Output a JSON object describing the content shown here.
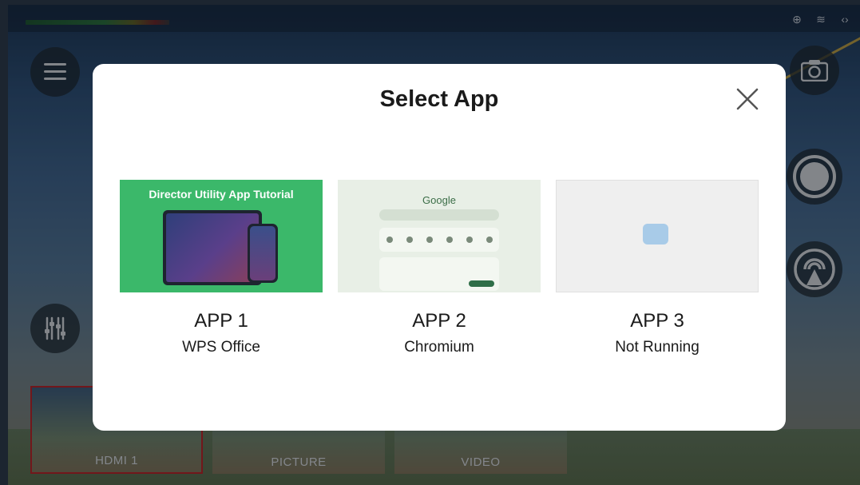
{
  "background": {
    "thumbnails": [
      {
        "label": "HDMI 1",
        "active": true
      },
      {
        "label": "PICTURE",
        "active": false
      },
      {
        "label": "VIDEO",
        "active": false
      }
    ]
  },
  "modal": {
    "title": "Select App",
    "apps": [
      {
        "name": "APP 1",
        "status": "WPS Office",
        "thumb_title": "Director Utility App Tutorial"
      },
      {
        "name": "APP 2",
        "status": "Chromium",
        "thumb_logo": "Google"
      },
      {
        "name": "APP 3",
        "status": "Not Running"
      }
    ]
  },
  "colors": {
    "active_border": "#b0242a",
    "modal_bg": "#ffffff",
    "app1_bg": "#3bb86a"
  },
  "icons": {
    "menu": "menu-icon",
    "mixer": "mixer-icon",
    "camera": "camera-icon",
    "record": "record-icon",
    "stream": "stream-icon",
    "close": "close-icon"
  }
}
